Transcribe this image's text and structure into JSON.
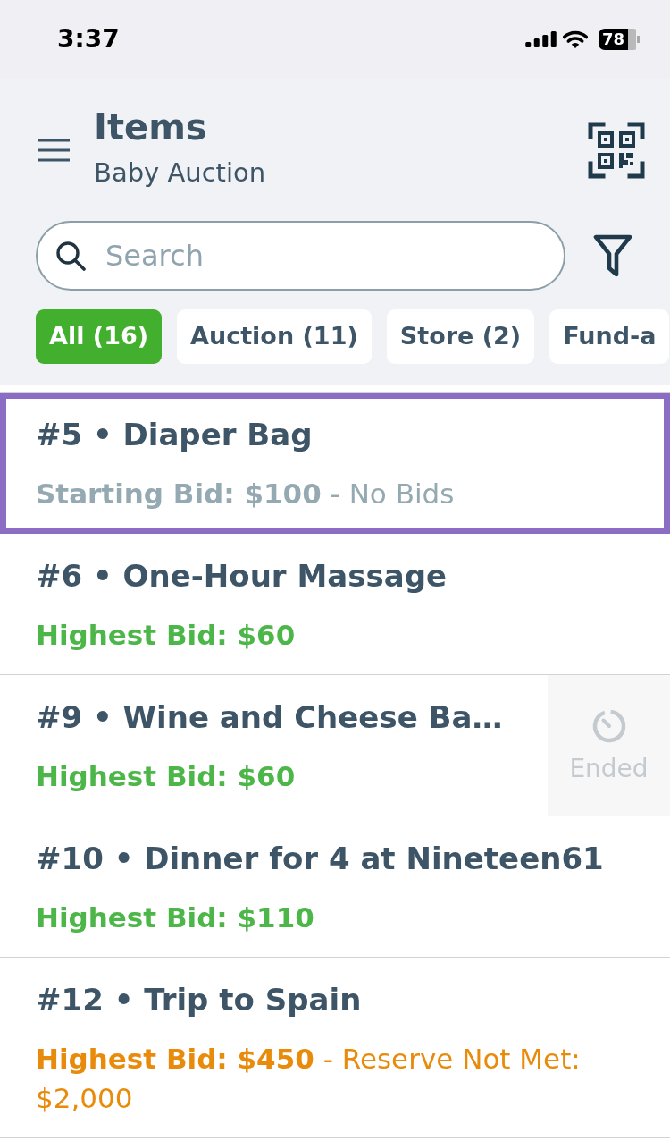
{
  "status_bar": {
    "time": "3:37",
    "battery": "78"
  },
  "header": {
    "title": "Items",
    "subtitle": "Baby Auction"
  },
  "search": {
    "placeholder": "Search"
  },
  "filters": [
    {
      "label": "All (16)",
      "selected": true
    },
    {
      "label": "Auction (11)",
      "selected": false
    },
    {
      "label": "Store (2)",
      "selected": false
    },
    {
      "label": "Fund-a",
      "selected": false
    }
  ],
  "items": [
    {
      "title": "#5 • Diaper Bag",
      "bid": "Starting Bid: $100",
      "note": "- No Bids",
      "color": "#94a9b2",
      "selected": true
    },
    {
      "title": "#6 • One-Hour Massage",
      "bid": "Highest Bid: $60",
      "color": "#4cb648",
      "selected": false
    },
    {
      "title": "#9 • Wine and Cheese Ba…",
      "bid": "Highest Bid: $60",
      "color": "#4cb648",
      "selected": false,
      "badge": "Ended"
    },
    {
      "title": "#10 • Dinner for 4 at Nineteen61",
      "bid": "Highest Bid: $110",
      "color": "#4cb648",
      "selected": false
    },
    {
      "title": "#12 • Trip to Spain",
      "bid": "Highest Bid: $450",
      "note": "- Reserve Not Met: $2,000",
      "color": "#e98b0a",
      "selected": false
    }
  ]
}
